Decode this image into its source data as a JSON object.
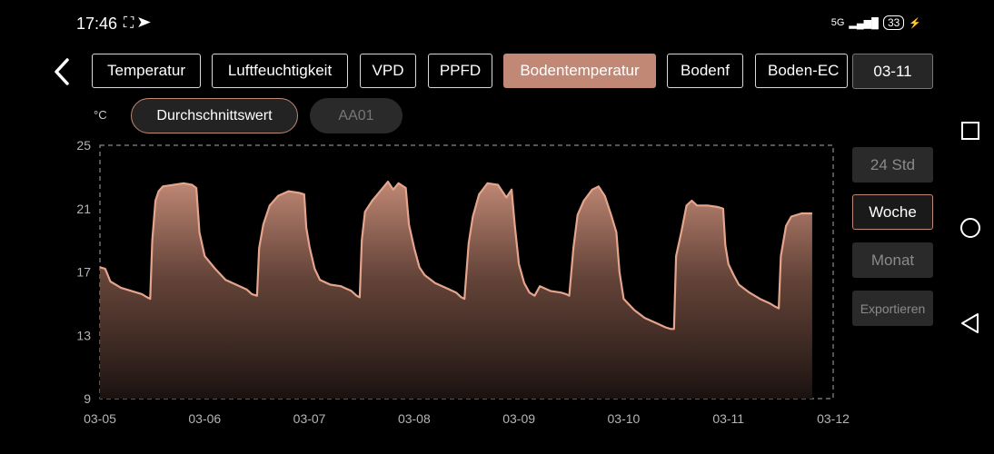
{
  "status_bar": {
    "time": "17:46",
    "signal": "5G",
    "battery": "33"
  },
  "tabs": [
    {
      "label": "Temperatur",
      "active": false
    },
    {
      "label": "Luftfeuchtigkeit",
      "active": false
    },
    {
      "label": "VPD",
      "active": false
    },
    {
      "label": "PPFD",
      "active": false
    },
    {
      "label": "Bodentemperatur",
      "active": true
    },
    {
      "label": "Bodenf",
      "active": false
    },
    {
      "label": "Boden-EC",
      "active": false
    }
  ],
  "date_selector": "03-11",
  "unit_label": "°C",
  "filters": {
    "average": "Durchschnittswert",
    "sensor": "AA01"
  },
  "range_buttons": {
    "day": "24 Std",
    "week": "Woche",
    "month": "Monat",
    "export": "Exportieren",
    "selected": "week"
  },
  "colors": {
    "accent": "#c08875",
    "line": "#e5a58c"
  },
  "chart_data": {
    "type": "area",
    "x_tick_labels": [
      "03-05",
      "03-06",
      "03-07",
      "03-08",
      "03-09",
      "03-10",
      "03-11",
      "03-12"
    ],
    "y_tick_labels": [
      "25",
      "21",
      "17",
      "13",
      "9"
    ],
    "ylim": [
      9,
      25
    ],
    "xlim": [
      0,
      7
    ],
    "grid": "dashed border",
    "series": [
      {
        "points": [
          [
            0.0,
            17.3
          ],
          [
            0.05,
            17.2
          ],
          [
            0.1,
            16.4
          ],
          [
            0.2,
            16.0
          ],
          [
            0.3,
            15.8
          ],
          [
            0.4,
            15.6
          ],
          [
            0.45,
            15.4
          ],
          [
            0.48,
            15.3
          ],
          [
            0.5,
            19.0
          ],
          [
            0.53,
            21.5
          ],
          [
            0.56,
            22.1
          ],
          [
            0.6,
            22.4
          ],
          [
            0.7,
            22.5
          ],
          [
            0.8,
            22.6
          ],
          [
            0.88,
            22.5
          ],
          [
            0.92,
            22.3
          ],
          [
            0.95,
            19.5
          ],
          [
            1.0,
            18.0
          ],
          [
            1.1,
            17.2
          ],
          [
            1.2,
            16.5
          ],
          [
            1.3,
            16.2
          ],
          [
            1.4,
            15.9
          ],
          [
            1.45,
            15.6
          ],
          [
            1.5,
            15.5
          ],
          [
            1.52,
            18.5
          ],
          [
            1.56,
            20.0
          ],
          [
            1.62,
            21.2
          ],
          [
            1.7,
            21.8
          ],
          [
            1.8,
            22.1
          ],
          [
            1.9,
            22.0
          ],
          [
            1.95,
            21.9
          ],
          [
            1.97,
            19.8
          ],
          [
            2.0,
            18.6
          ],
          [
            2.05,
            17.2
          ],
          [
            2.1,
            16.5
          ],
          [
            2.2,
            16.2
          ],
          [
            2.3,
            16.1
          ],
          [
            2.4,
            15.8
          ],
          [
            2.45,
            15.5
          ],
          [
            2.48,
            15.4
          ],
          [
            2.5,
            19.0
          ],
          [
            2.53,
            20.8
          ],
          [
            2.6,
            21.5
          ],
          [
            2.7,
            22.3
          ],
          [
            2.75,
            22.7
          ],
          [
            2.8,
            22.2
          ],
          [
            2.85,
            22.6
          ],
          [
            2.92,
            22.3
          ],
          [
            2.95,
            20.0
          ],
          [
            3.0,
            18.5
          ],
          [
            3.05,
            17.3
          ],
          [
            3.1,
            16.8
          ],
          [
            3.2,
            16.3
          ],
          [
            3.3,
            16.0
          ],
          [
            3.4,
            15.7
          ],
          [
            3.45,
            15.4
          ],
          [
            3.48,
            15.3
          ],
          [
            3.52,
            18.8
          ],
          [
            3.56,
            20.5
          ],
          [
            3.62,
            21.9
          ],
          [
            3.7,
            22.6
          ],
          [
            3.8,
            22.5
          ],
          [
            3.88,
            21.7
          ],
          [
            3.93,
            22.2
          ],
          [
            3.96,
            20.0
          ],
          [
            4.0,
            17.5
          ],
          [
            4.05,
            16.3
          ],
          [
            4.1,
            15.7
          ],
          [
            4.15,
            15.5
          ],
          [
            4.2,
            16.1
          ],
          [
            4.3,
            15.8
          ],
          [
            4.4,
            15.7
          ],
          [
            4.45,
            15.6
          ],
          [
            4.48,
            15.5
          ],
          [
            4.52,
            18.5
          ],
          [
            4.56,
            20.6
          ],
          [
            4.62,
            21.5
          ],
          [
            4.7,
            22.2
          ],
          [
            4.76,
            22.4
          ],
          [
            4.82,
            21.8
          ],
          [
            4.88,
            20.6
          ],
          [
            4.93,
            19.5
          ],
          [
            4.96,
            17.0
          ],
          [
            5.0,
            15.3
          ],
          [
            5.1,
            14.6
          ],
          [
            5.2,
            14.1
          ],
          [
            5.3,
            13.8
          ],
          [
            5.4,
            13.5
          ],
          [
            5.45,
            13.4
          ],
          [
            5.48,
            13.4
          ],
          [
            5.5,
            18.0
          ],
          [
            5.55,
            19.5
          ],
          [
            5.6,
            21.2
          ],
          [
            5.65,
            21.5
          ],
          [
            5.7,
            21.2
          ],
          [
            5.8,
            21.2
          ],
          [
            5.9,
            21.1
          ],
          [
            5.95,
            21.0
          ],
          [
            5.97,
            18.7
          ],
          [
            6.0,
            17.5
          ],
          [
            6.05,
            16.8
          ],
          [
            6.1,
            16.2
          ],
          [
            6.2,
            15.7
          ],
          [
            6.3,
            15.3
          ],
          [
            6.4,
            15.0
          ],
          [
            6.45,
            14.8
          ],
          [
            6.48,
            14.7
          ],
          [
            6.5,
            18.0
          ],
          [
            6.55,
            19.9
          ],
          [
            6.6,
            20.5
          ],
          [
            6.7,
            20.7
          ],
          [
            6.78,
            20.7
          ],
          [
            6.8,
            20.7
          ]
        ]
      }
    ]
  }
}
